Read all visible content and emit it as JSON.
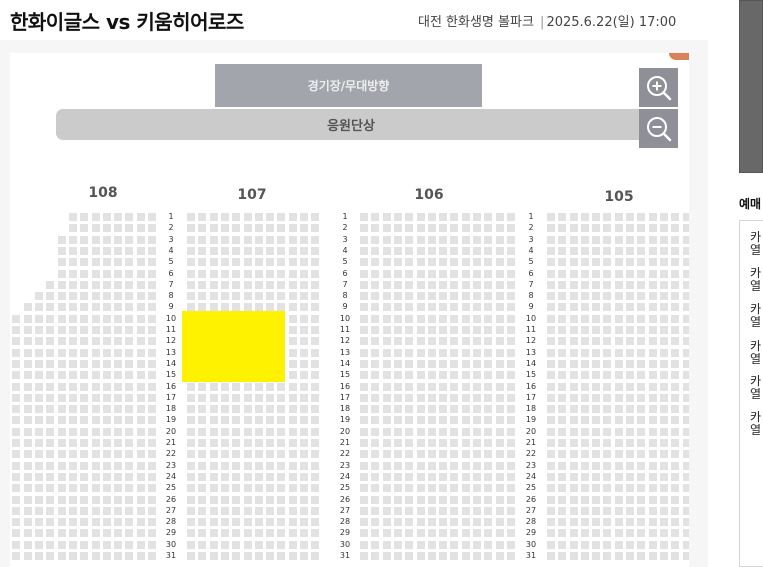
{
  "header": {
    "title": "한화이글스 vs 키움히어로즈",
    "venue": "대전 한화생명 볼파크",
    "separator": "|",
    "datetime": "2025.6.22(일) 17:00"
  },
  "map": {
    "stage_direction_label": "경기장/무대방향",
    "cheer_stage_label": "응원단상",
    "zoom_in_icon": "zoom-in-icon",
    "zoom_out_icon": "zoom-out-icon",
    "sections": [
      "108",
      "107",
      "106",
      "105"
    ],
    "row_numbers": [
      "1",
      "2",
      "3",
      "4",
      "5",
      "6",
      "7",
      "8",
      "9",
      "10",
      "11",
      "12",
      "13",
      "14",
      "15",
      "16",
      "17",
      "18",
      "19",
      "20",
      "21",
      "22",
      "23",
      "24",
      "25",
      "26",
      "27",
      "28",
      "29",
      "30",
      "31"
    ],
    "selected_area": {
      "section": "107",
      "rows": [
        "10",
        "11",
        "12",
        "13",
        "14",
        "15"
      ]
    },
    "colors": {
      "seat": "#e2e2e2",
      "selected": "#fff200",
      "stage": "#a3a5ad",
      "cheer_stage": "#cbcbcb",
      "zoom_button": "#8f9097"
    }
  },
  "sidebar": {
    "heading": "예매",
    "items": [
      {
        "line1": "카",
        "line2": "열"
      },
      {
        "line1": "카",
        "line2": "열"
      },
      {
        "line1": "카",
        "line2": "열"
      },
      {
        "line1": "카",
        "line2": "열"
      },
      {
        "line1": "카",
        "line2": "열"
      },
      {
        "line1": "카",
        "line2": "열"
      }
    ]
  }
}
